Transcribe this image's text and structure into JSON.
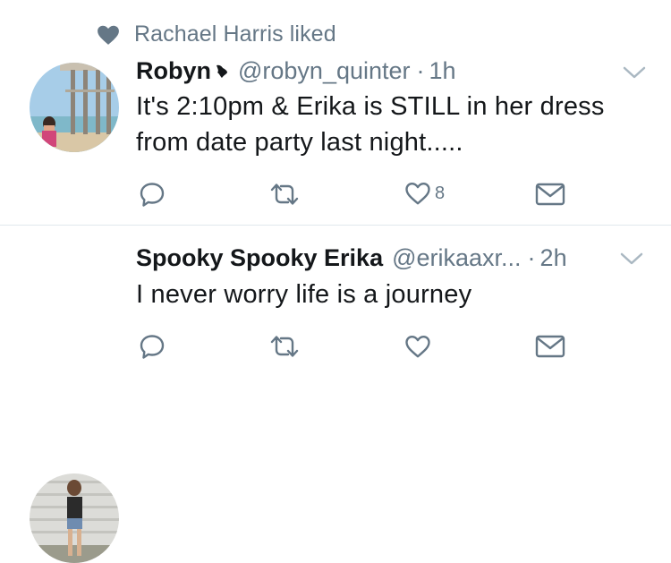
{
  "tweets": [
    {
      "social_context": {
        "icon": "heart-icon",
        "text": "Rachael Harris liked"
      },
      "author": {
        "name": "Robyn",
        "badge_icon": "heart-emoji-icon",
        "handle": "@robyn_quinter",
        "time": "1h"
      },
      "text": "It's 2:10pm & Erika is STILL in her dress from date party last night.....",
      "actions": {
        "reply": "",
        "retweet": "",
        "like": "8",
        "message": ""
      }
    },
    {
      "author": {
        "name": "Spooky Spooky Erika",
        "handle": "@erikaaxr...",
        "time": "2h"
      },
      "text": "I never worry life is a journey",
      "actions": {
        "reply": "",
        "retweet": "",
        "like": "",
        "message": ""
      }
    }
  ],
  "separator": "·",
  "colors": {
    "text": "#14171a",
    "secondary": "#657786",
    "icon": "#1da1f2",
    "divider": "#e1e8ed"
  }
}
